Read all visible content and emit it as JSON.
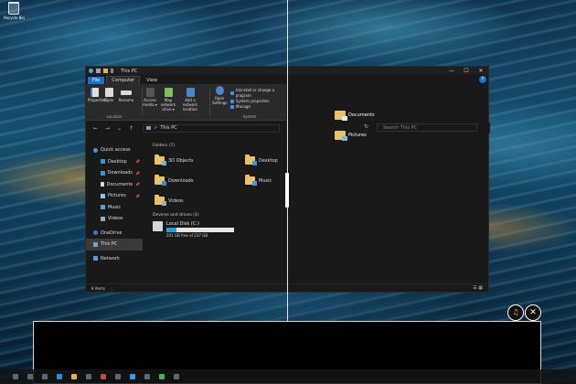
{
  "desktop": {
    "recycle_bin_label": "Recycle Bin"
  },
  "window": {
    "title": "This PC",
    "controls": {
      "minimize": "—",
      "maximize": "☐",
      "close": "✕",
      "help": "?"
    },
    "tabs": [
      {
        "label": "File"
      },
      {
        "label": "Computer"
      },
      {
        "label": "View"
      }
    ],
    "ribbon": {
      "location_group": {
        "label": "Location",
        "buttons": [
          {
            "label": "Properties"
          },
          {
            "label": "Open"
          },
          {
            "label": "Rename"
          }
        ]
      },
      "network_group": {
        "buttons": [
          {
            "label": "Access media ▾"
          },
          {
            "label": "Map network drive ▾"
          },
          {
            "label": "Add a network location"
          }
        ]
      },
      "system_group": {
        "label": "System",
        "open_settings_label": "Open Settings",
        "items": [
          {
            "label": "Uninstall or change a program"
          },
          {
            "label": "System properties"
          },
          {
            "label": "Manage"
          }
        ]
      }
    },
    "address": {
      "back": "←",
      "forward": "→",
      "down": "⌄",
      "up": "↑",
      "path_sep": ">",
      "path": "This PC",
      "refresh": "↻",
      "search_placeholder": "Search This PC"
    },
    "sidebar": {
      "items": [
        {
          "label": "Quick access",
          "pin": ""
        },
        {
          "label": "Desktop",
          "pin": "📌"
        },
        {
          "label": "Downloads",
          "pin": "📌"
        },
        {
          "label": "Documents",
          "pin": "📌"
        },
        {
          "label": "Pictures",
          "pin": "📌"
        },
        {
          "label": "Music",
          "pin": ""
        },
        {
          "label": "Videos",
          "pin": ""
        },
        {
          "label": "OneDrive",
          "pin": ""
        },
        {
          "label": "This PC",
          "pin": ""
        },
        {
          "label": "Network",
          "pin": ""
        }
      ]
    },
    "content": {
      "folders_header": "Folders (7)",
      "folders": [
        "3D Objects",
        "Desktop",
        "Downloads",
        "Music",
        "Videos"
      ],
      "devices_header": "Devices and drives (1)",
      "drive": {
        "name": "Local Disk (C:)",
        "free_text": "201 GB free of 237 GB",
        "used_fraction": 0.152
      }
    },
    "statusbar": {
      "items": "8 items",
      "sep": "|"
    }
  },
  "right_pane": {
    "icons": [
      {
        "label": "Documents"
      },
      {
        "label": "Pictures"
      }
    ]
  },
  "bottom_buttons": {
    "snap_icon_glyph": "♫",
    "close_glyph": "✕"
  }
}
